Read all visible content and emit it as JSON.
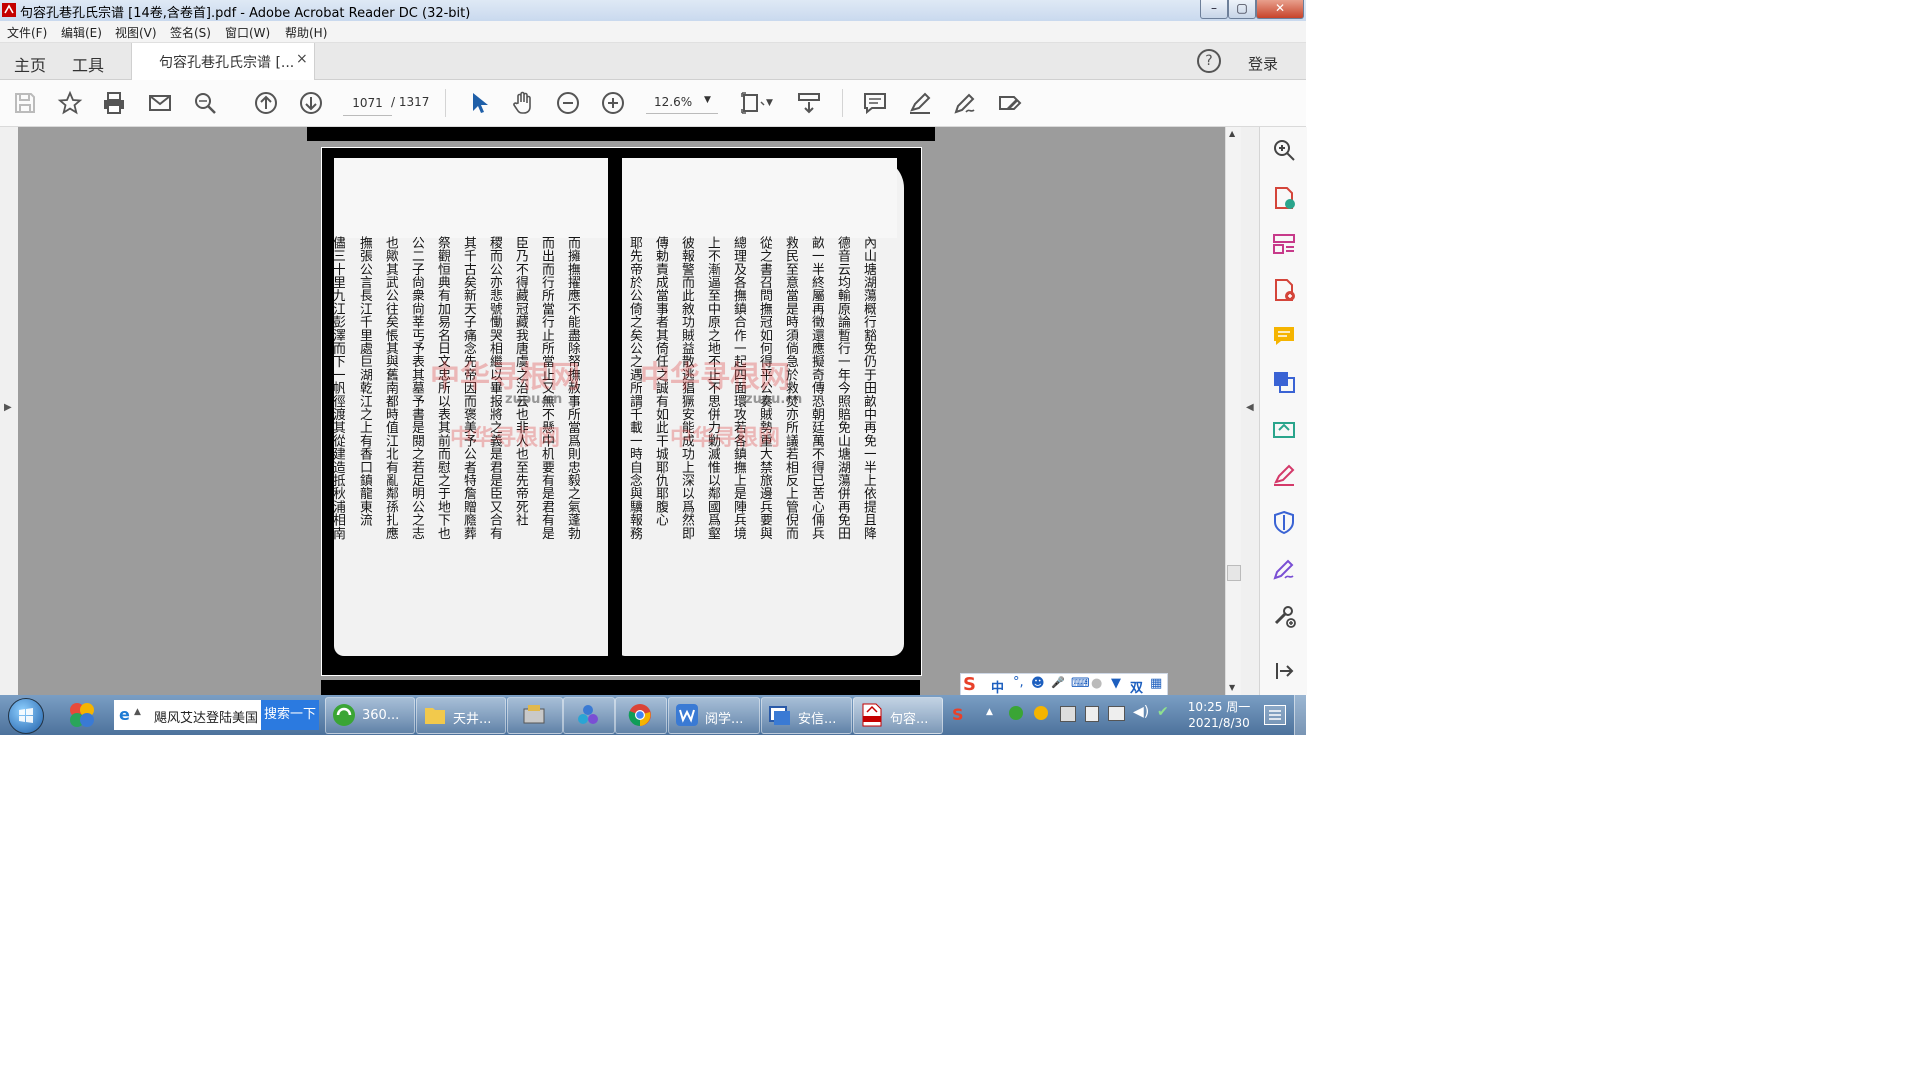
{
  "window": {
    "title": "句容孔巷孔氏宗谱 [14卷,含卷首].pdf - Adobe Acrobat Reader DC (32-bit)",
    "min": "–",
    "max": "▢",
    "close": "✕"
  },
  "menu": [
    "文件(F)",
    "编辑(E)",
    "视图(V)",
    "签名(S)",
    "窗口(W)",
    "帮助(H)"
  ],
  "tabs": {
    "home": "主页",
    "tools": "工具",
    "doc": "句容孔巷孔氏宗谱 [...",
    "close": "×",
    "help": "?",
    "login": "登录"
  },
  "toolbar": {
    "page_current": "1071",
    "page_total": "/ 1317",
    "zoom": "12.6%"
  },
  "document": {
    "right_columns": [
      "內山塘湖蕩概行豁免仍于田畝中再免一半上依提且降",
      "德音云均輸原論暫行一年今照賠免山塘湖蕩併再免田",
      "畝一半終屬再徵還應擬奇傳恐朝廷萬不得已苦心倆兵",
      "救民至意當是時須倘急於救焚亦所議若相反上管倪而",
      "從之書召問撫冠如何得平公奏賊勢重大禁旅邊兵要與",
      "總理及各撫鎮合作一起四面環攻若各鎮撫上是陣兵境",
      "上不漸逼至中原之地不止不思併力勦滅惟以鄰國爲壑",
      "彼報警而此敘功賊益散逃猖獗安能成功上深以爲然即",
      "傳勅責成當事者其倚任之誠有如此干城耶仇耶腹心",
      "耶先帝於公倚之矣公之遇所謂千載一時自念與驥報務"
    ],
    "left_columns": [
      "而擁撫擢應不能盡除帑撫赦事所當爲則忠毅之氣蓬勃",
      "而出而行所當行止所當止又無不懸中机要有是君有是",
      "臣乃不得藏冠藏我唐虞之治云也非人也至先帝死社",
      "稷而公亦悲號慟哭相繼以畢报將之義是君是臣又合有",
      "其千古矣新天子痛念先帝因而褒美予公者特詹贈廕葬",
      "祭觀恒典有加易名日文忠所以表其前而慰之于地下也",
      "公二子尙衆尙莘丐予表其墓予書是閱之若足明公之志",
      "也歟其武公往矣悵其與舊南都時值江北有亂鄰孫扎應",
      "撫張公言長江千里處巨湖乾江之上有香口鎮龍東流",
      "儘三十里九江彭澤而下一帆徑渡其從建造抵秋浦相南"
    ],
    "watermarks": [
      "中华寻根网",
      "zupu.cn"
    ]
  },
  "taskbar": {
    "search_text": "飓风艾达登陆美国",
    "search_button": "搜索一下",
    "items": [
      "360...",
      "天井...",
      "",
      "",
      "",
      "阅学...",
      "安信...",
      "句容..."
    ],
    "time": "10:25 周一",
    "date": "2021/8/30"
  },
  "ime": {
    "lang": "中",
    "punct": "°,",
    "emoji": "☻",
    "mic": "🎤",
    "keyboard": "⌨",
    "width": "双"
  }
}
